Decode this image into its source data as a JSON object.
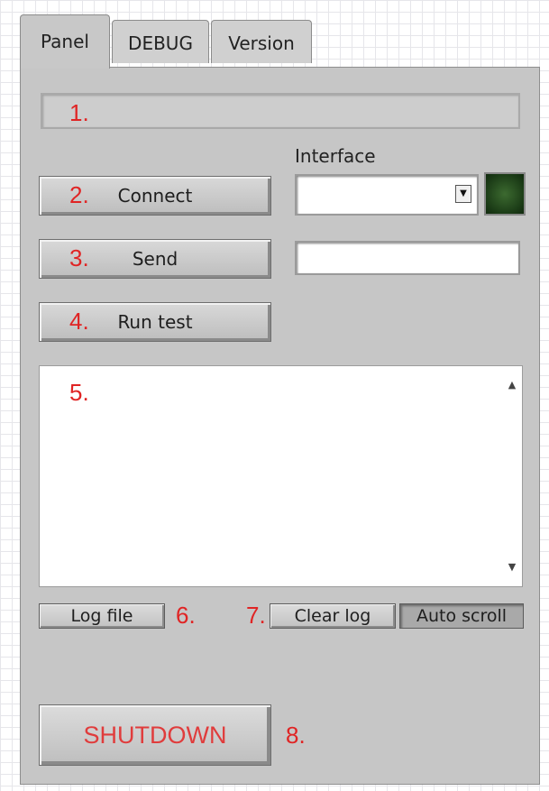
{
  "tabs": [
    {
      "label": "Panel",
      "active": true
    },
    {
      "label": "DEBUG",
      "active": false
    },
    {
      "label": "Version",
      "active": false
    }
  ],
  "markers": {
    "m1": "1.",
    "m2": "2.",
    "m3": "3.",
    "m4": "4.",
    "m5": "5.",
    "m6": "6.",
    "m7": "7.",
    "m8": "8."
  },
  "status_field": {
    "value": ""
  },
  "buttons": {
    "connect": "Connect",
    "send": "Send",
    "run_test": "Run test",
    "log_file": "Log file",
    "clear_log": "Clear log",
    "auto_scroll": "Auto scroll",
    "shutdown": "SHUTDOWN"
  },
  "interface": {
    "label": "Interface",
    "selected": "",
    "led_on": true
  },
  "send_input": {
    "value": ""
  },
  "log": {
    "content": ""
  },
  "colors": {
    "marker_red": "#e02424",
    "shutdown_text": "#e03c3c",
    "led_green": "#2a5322",
    "panel_grey": "#c6c6c6"
  },
  "icons": {
    "dropdown": "triangle-down",
    "scroll_up": "triangle-up",
    "scroll_down": "triangle-down"
  }
}
